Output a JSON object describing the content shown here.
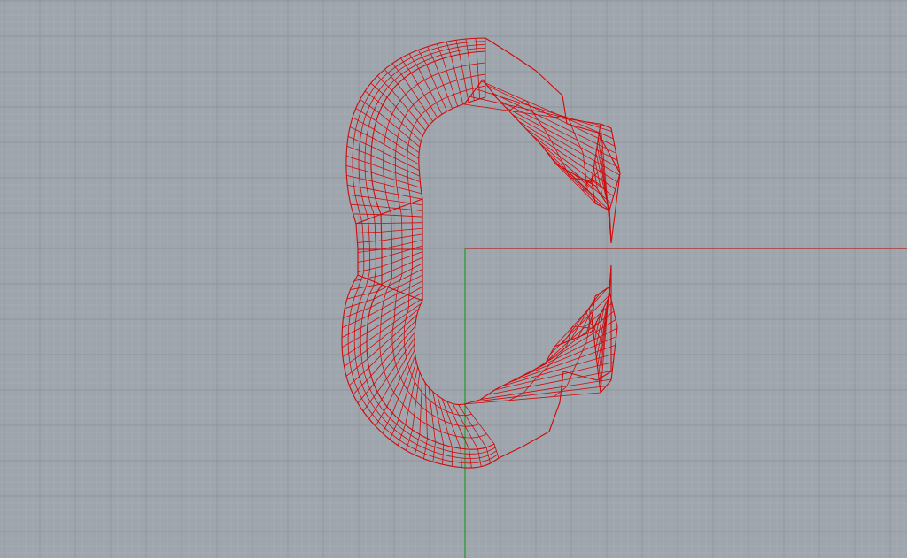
{
  "viewport": {
    "view": "Top",
    "background_color": "#9ea5ad",
    "minor_grid_color": "#a9afb6",
    "major_grid_color": "#8e959d",
    "x_axis_color": "#b31f1f",
    "y_axis_color": "#1f9a2b",
    "wireframe_color": "#d10a0a",
    "grid_visible": true,
    "axes_visible": true
  },
  "model": {
    "object_type": "wireframe-surface",
    "shape": "open-ring-c",
    "selected": false
  }
}
